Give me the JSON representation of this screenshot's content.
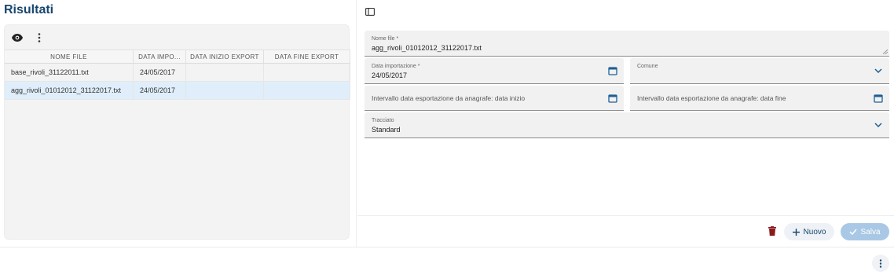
{
  "page": {
    "title": "Risultati"
  },
  "grid": {
    "columns": [
      "NOME FILE",
      "DATA IMPO...",
      "DATA INIZIO EXPORT",
      "DATA FINE EXPORT"
    ],
    "rows": [
      {
        "nome_file": "base_rivoli_31122011.txt",
        "data_importazione": "24/05/2017",
        "data_inizio": "",
        "data_fine": ""
      },
      {
        "nome_file": "agg_rivoli_01012012_31122017.txt",
        "data_importazione": "24/05/2017",
        "data_inizio": "",
        "data_fine": ""
      }
    ],
    "selected_row": 1
  },
  "form": {
    "nome_file": {
      "label": "Nome file *",
      "value": "agg_rivoli_01012012_31122017.txt"
    },
    "data_importazione": {
      "label": "Data importazione *",
      "value": "24/05/2017"
    },
    "comune": {
      "label": "Comune",
      "value": ""
    },
    "data_inizio": {
      "placeholder": "Intervallo data esportazione da anagrafe: data inizio"
    },
    "data_fine": {
      "placeholder": "Intervallo data esportazione da anagrafe: data fine"
    },
    "tracciato": {
      "label": "Tracciato",
      "value": "Standard"
    }
  },
  "actions": {
    "nuovo_label": "Nuovo",
    "salva_label": "Salva"
  },
  "icons": {
    "visibility": "eye-icon",
    "more": "more-vert-icon",
    "layout": "sidebar-panel-icon",
    "calendar": "calendar-icon",
    "dropdown": "chevron-down-icon",
    "delete": "trash-icon",
    "add": "plus-icon",
    "save": "check-icon"
  },
  "colors": {
    "primary": "#17466e",
    "accent": "#1f5f96",
    "danger": "#8b1a1a",
    "selected_row": "#dfeefa",
    "save_disabled": "#a9c8e5"
  }
}
